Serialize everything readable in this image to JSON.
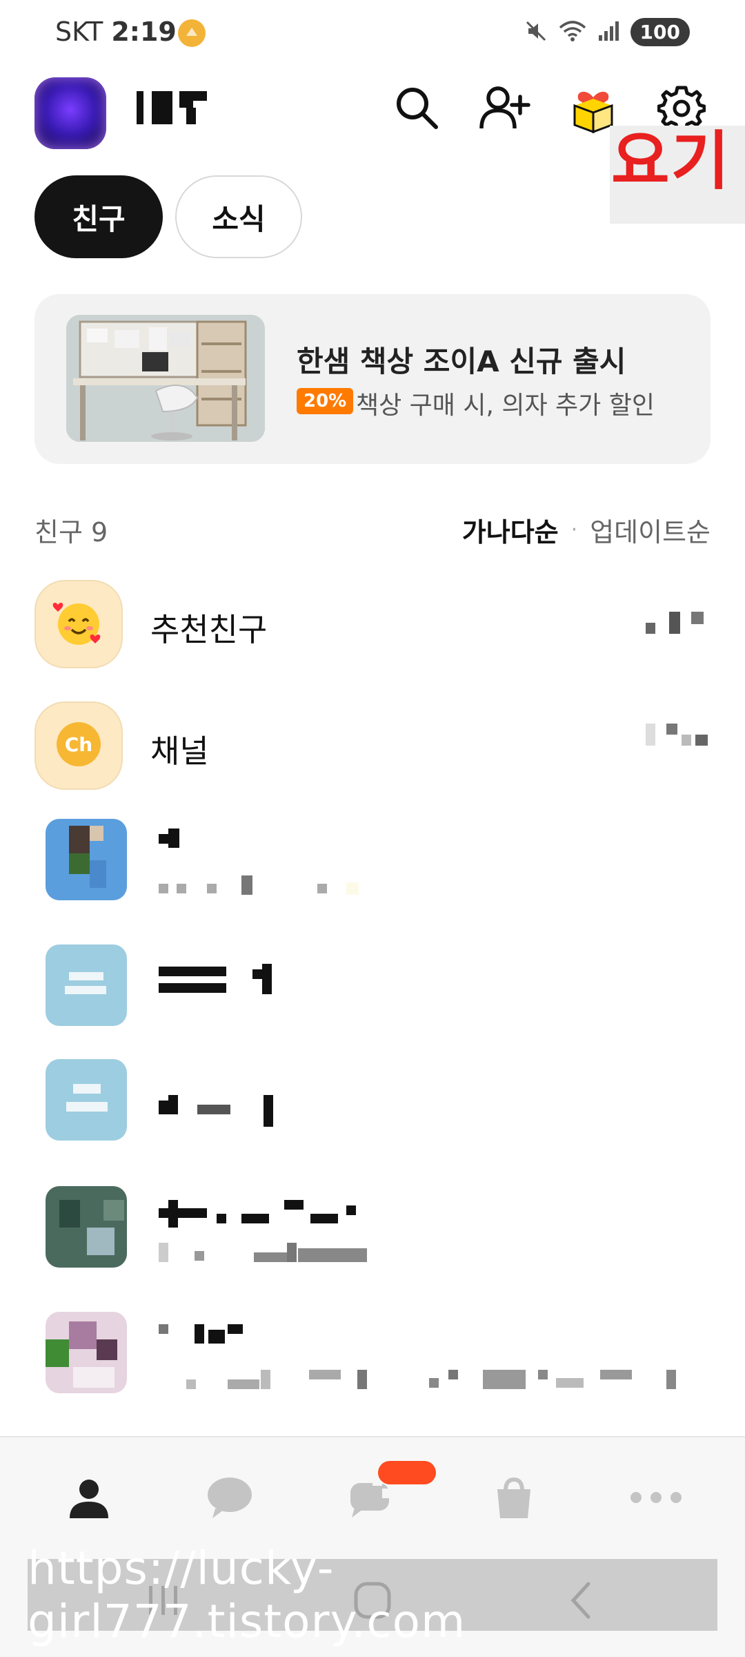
{
  "status_bar": {
    "carrier": "SKT",
    "time": "2:19",
    "battery": "100"
  },
  "header": {
    "icons": [
      "search-icon",
      "add-friend-icon",
      "gift-icon",
      "settings-icon"
    ]
  },
  "annotation": {
    "text": "요기",
    "color": "#e8201f"
  },
  "tabs": [
    {
      "label": "친구",
      "active": true
    },
    {
      "label": "소식",
      "active": false
    }
  ],
  "banner": {
    "title": "한샘 책상 조이A 신규 출시",
    "badge": "20%",
    "subtitle": "책상 구매 시, 의자 추가 할인",
    "badge_color": "#ff7a00"
  },
  "friends_section": {
    "count_label": "친구 9",
    "sort_active": "가나다순",
    "sort_inactive": "업데이트순"
  },
  "special_rows": [
    {
      "label": "추천친구",
      "icon": "smiling-face-hearts-icon"
    },
    {
      "label": "채널",
      "icon": "channel-ch-icon"
    }
  ],
  "bottom_nav": {
    "items": [
      "friends-icon",
      "chat-icon",
      "open-chat-icon",
      "shopping-icon",
      "more-icon"
    ]
  },
  "watermark": "https://lucky-girl777.tistory.com"
}
